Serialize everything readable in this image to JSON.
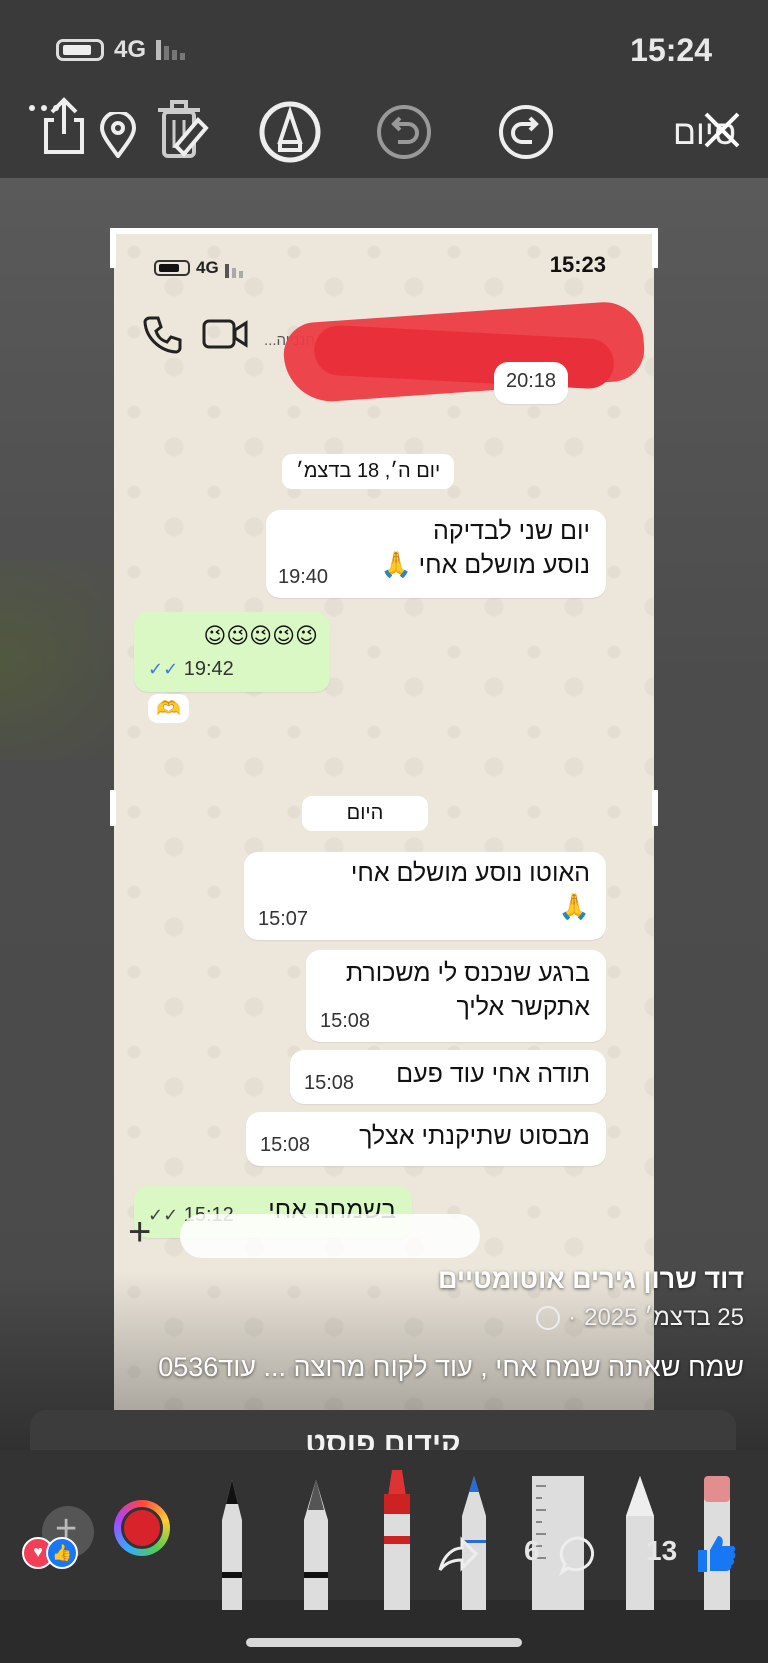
{
  "status": {
    "network": "4G",
    "time": "15:24"
  },
  "toolbar": {
    "done_label": "סיום",
    "buttons": [
      "share-icon",
      "location-icon",
      "trash-icon",
      "pen-circle-icon",
      "undo-icon",
      "redo-icon",
      "close-icon"
    ]
  },
  "screenshot": {
    "status": {
      "network": "4G",
      "time": "15:23"
    },
    "header_name": "...ג'ר חננייה",
    "top_time": "20:18",
    "day1": "יום ה׳, 18 בדצמ׳",
    "day2": "היום",
    "messages": [
      {
        "dir": "in",
        "lines": [
          "יום שני לבדיקה",
          "נוסע מושלם אחי 🙏"
        ],
        "time": "19:40"
      },
      {
        "dir": "out",
        "lines": [
          "😉😉😉😉😉"
        ],
        "time": "19:42",
        "reaction": "🫶"
      },
      {
        "dir": "in",
        "lines": [
          "האוטו נוסע מושלם אחי",
          "🙏"
        ],
        "time": "15:07"
      },
      {
        "dir": "in",
        "lines": [
          "ברגע שנכנס לי משכורת",
          "אתקשר אליך"
        ],
        "time": "15:08"
      },
      {
        "dir": "in",
        "lines": [
          "תודה אחי עוד פעם"
        ],
        "time": "15:08"
      },
      {
        "dir": "in",
        "lines": [
          "מבסוט שתיקנתי אצלך"
        ],
        "time": "15:08"
      },
      {
        "dir": "out",
        "lines": [
          "בשמחה אחי"
        ],
        "time": "15:12"
      }
    ]
  },
  "post": {
    "author": "דוד שרון גירים אוטומטיים",
    "date": "25 בדצמ׳ 2025",
    "separator": "·",
    "text": "שמח שאתה שמח אחי , עוד לקוח מרוצה ... עוד0536",
    "promote_label": "קידום פוסט",
    "likes_count": "13",
    "comments_count": "6"
  },
  "colors": {
    "outgoing_bubble": "#d9f8c4",
    "redaction": "#ec3c45",
    "chat_bg": "#ece6db",
    "toolbar_bg": "#3a3a3a"
  }
}
